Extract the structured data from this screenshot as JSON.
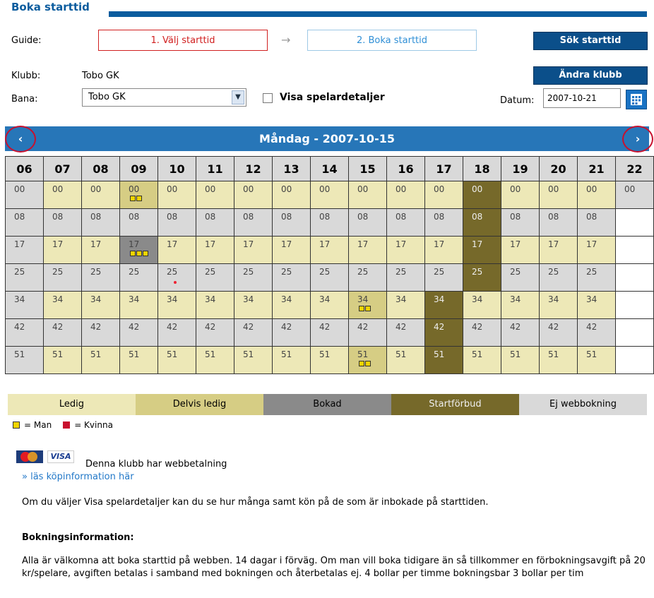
{
  "header": {
    "title": "Boka starttid"
  },
  "guide": {
    "label": "Guide:",
    "step1": "1. Välj starttid",
    "arrow": "→",
    "step2": "2. Boka starttid",
    "search_button": "Sök starttid"
  },
  "club": {
    "label": "Klubb:",
    "value": "Tobo GK",
    "change_button": "Ändra klubb"
  },
  "course": {
    "label": "Bana:",
    "selected": "Tobo GK"
  },
  "show_players": {
    "label": "Visa spelardetaljer",
    "checked": false
  },
  "date": {
    "label": "Datum:",
    "value": "2007-10-21"
  },
  "calendar": {
    "day_title": "Måndag - 2007-10-15",
    "prev": "‹",
    "next": "›",
    "hours": [
      "06",
      "07",
      "08",
      "09",
      "10",
      "11",
      "12",
      "13",
      "14",
      "15",
      "16",
      "17",
      "18",
      "19",
      "20",
      "21",
      "22"
    ],
    "rows": [
      [
        "00",
        "00",
        "00",
        "00",
        "00",
        "00",
        "00",
        "00",
        "00",
        "00",
        "00",
        "00",
        "00",
        "00",
        "00",
        "00",
        "00"
      ],
      [
        "08",
        "08",
        "08",
        "08",
        "08",
        "08",
        "08",
        "08",
        "08",
        "08",
        "08",
        "08",
        "08",
        "08",
        "08",
        "08",
        ""
      ],
      [
        "17",
        "17",
        "17",
        "17",
        "17",
        "17",
        "17",
        "17",
        "17",
        "17",
        "17",
        "17",
        "17",
        "17",
        "17",
        "17",
        ""
      ],
      [
        "25",
        "25",
        "25",
        "25",
        "25",
        "25",
        "25",
        "25",
        "25",
        "25",
        "25",
        "25",
        "25",
        "25",
        "25",
        "25",
        ""
      ],
      [
        "34",
        "34",
        "34",
        "34",
        "34",
        "34",
        "34",
        "34",
        "34",
        "34",
        "34",
        "34",
        "34",
        "34",
        "34",
        "34",
        ""
      ],
      [
        "42",
        "42",
        "42",
        "42",
        "42",
        "42",
        "42",
        "42",
        "42",
        "42",
        "42",
        "42",
        "42",
        "42",
        "42",
        "42",
        ""
      ],
      [
        "51",
        "51",
        "51",
        "51",
        "51",
        "51",
        "51",
        "51",
        "51",
        "51",
        "51",
        "51",
        "51",
        "51",
        "51",
        "51",
        ""
      ]
    ]
  },
  "legend": {
    "ledig": "Ledig",
    "delvis": "Delvis ledig",
    "bokad": "Bokad",
    "forbud": "Startförbud",
    "ej_webb": "Ej webbokning",
    "man": "= Man",
    "kvinna": "= Kvinna"
  },
  "payment": {
    "visa": "VISA",
    "info": "Denna klubb har webbetalning",
    "link": "» läs köpinformation här"
  },
  "info_text": "Om du väljer Visa spelardetaljer kan du se hur många samt kön på de som är inbokade på starttiden.",
  "booking": {
    "heading": "Bokningsinformation:",
    "text": "Alla är välkomna att boka starttid på webben. 14 dagar i förväg. Om man vill boka tidigare än så tillkommer en förbokningsavgift på 20 kr/spelare, avgiften betalas i samband med bokningen och återbetalas ej. 4 bollar per timme bokningsbar 3 bollar per tim"
  },
  "colors": {
    "ledig": "#ede8b7",
    "delvis": "#d6cd84",
    "bokad": "#8a8a8a",
    "forbud": "#76692a",
    "ej_webb": "#d9d9d9",
    "accent": "#0b5c9e"
  }
}
